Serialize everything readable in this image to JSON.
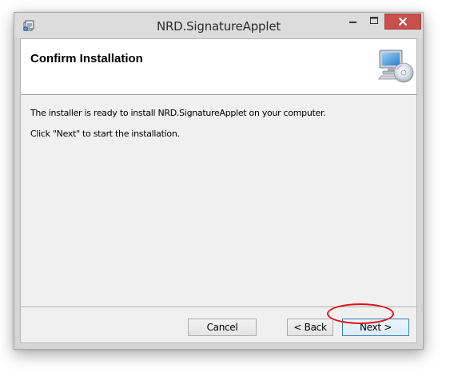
{
  "window": {
    "title": "NRD.SignatureApplet",
    "caption_buttons": {
      "minimize_icon": "minimize-icon",
      "maximize_icon": "maximize-icon",
      "close_icon": "close-icon"
    },
    "close_color": "#c7504d"
  },
  "banner": {
    "title": "Confirm Installation",
    "icon": "computer-cd-icon"
  },
  "body": {
    "line1": "The installer is ready to install NRD.SignatureApplet on your computer.",
    "line2": "Click \"Next\" to start the installation."
  },
  "buttons": {
    "cancel": "Cancel",
    "back": "< Back",
    "next": "Next >"
  },
  "annotation": {
    "highlight_color": "#e0101a",
    "highlight_target": "next-button"
  }
}
